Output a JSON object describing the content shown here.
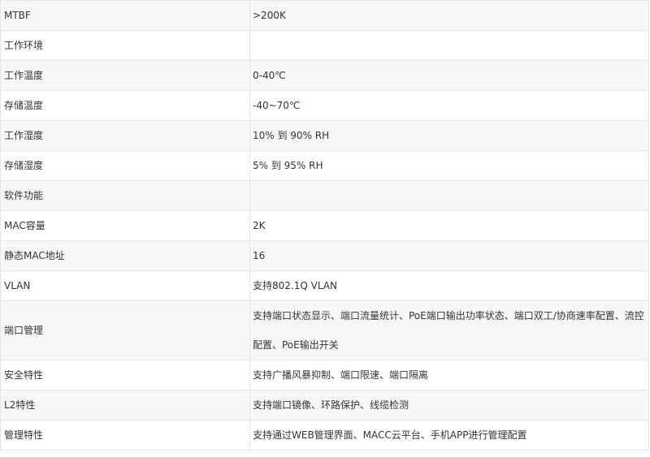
{
  "specs": {
    "rows": [
      {
        "label": "MTBF",
        "value": ">200K"
      },
      {
        "label": "工作环境",
        "value": ""
      },
      {
        "label": "工作温度",
        "value": "0-40℃"
      },
      {
        "label": "存储温度",
        "value": "-40~70℃"
      },
      {
        "label": "工作湿度",
        "value": "10% 到 90% RH"
      },
      {
        "label": "存储湿度",
        "value": "5% 到 95% RH"
      },
      {
        "label": "软件功能",
        "value": ""
      },
      {
        "label": "MAC容量",
        "value": "2K"
      },
      {
        "label": "静态MAC地址",
        "value": "16"
      },
      {
        "label": "VLAN",
        "value": "支持802.1Q VLAN"
      },
      {
        "label": "端口管理",
        "value": "支持端口状态显示、端口流量统计、PoE端口输出功率状态、端口双工/协商速率配置、流控配置、PoE输出开关"
      },
      {
        "label": "安全特性",
        "value": "支持广播风暴抑制、端口限速、端口隔离"
      },
      {
        "label": "L2特性",
        "value": "支持端口镜像、环路保护、线缆检测"
      },
      {
        "label": "管理特性",
        "value": "支持通过WEB管理界面、MACC云平台、手机APP进行管理配置"
      }
    ]
  }
}
